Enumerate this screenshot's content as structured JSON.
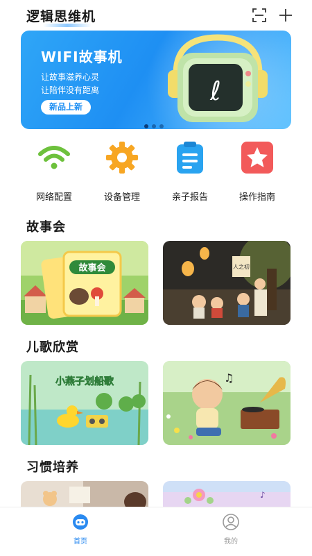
{
  "header": {
    "title": "逻辑思维机",
    "scan_icon": "scan-icon",
    "add_icon": "plus-icon"
  },
  "banner": {
    "title": "WIFI故事机",
    "subtitle1": "让故事滋养心灵",
    "subtitle2": "让陪伴没有距离",
    "badge": "新品上新",
    "page_count": 3,
    "active_page": 1
  },
  "quick_actions": [
    {
      "label": "网络配置",
      "icon": "wifi-icon",
      "color": "#6dc13c"
    },
    {
      "label": "设备管理",
      "icon": "gear-icon",
      "color": "#f7a623"
    },
    {
      "label": "亲子报告",
      "icon": "clipboard-icon",
      "color": "#29a3f0"
    },
    {
      "label": "操作指南",
      "icon": "star-icon",
      "color": "#f25a5a"
    }
  ],
  "sections": [
    {
      "title": "故事会",
      "cards": [
        {
          "text": "故事会"
        },
        {
          "text": "人之初"
        }
      ]
    },
    {
      "title": "儿歌欣赏",
      "cards": [
        {
          "text": "小燕子划船歌"
        },
        {
          "text": ""
        }
      ]
    },
    {
      "title": "习惯培养",
      "cards": [
        {
          "text": ""
        },
        {
          "text": ""
        }
      ]
    }
  ],
  "tabbar": {
    "items": [
      {
        "label": "首页",
        "icon": "robot-home-icon",
        "active": true
      },
      {
        "label": "我的",
        "icon": "user-icon",
        "active": false
      }
    ]
  },
  "colors": {
    "accent": "#1e8ff3",
    "tab_active": "#2a8af0",
    "tab_inactive": "#999999"
  }
}
